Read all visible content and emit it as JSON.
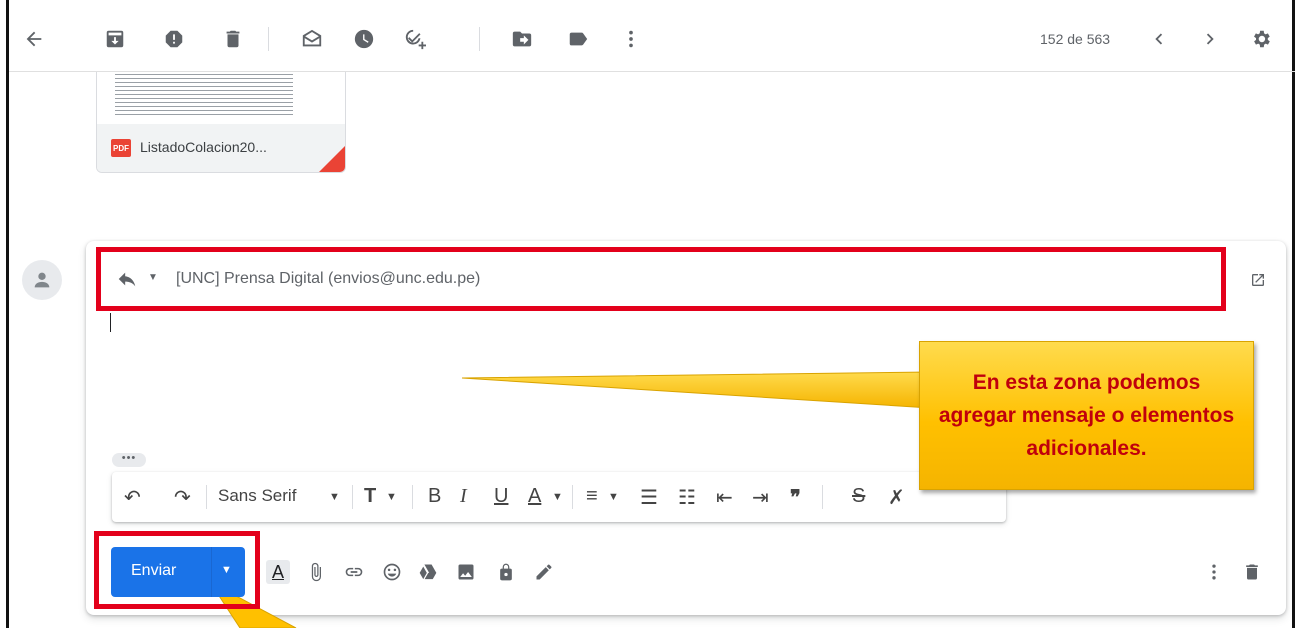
{
  "toolbar": {
    "back_icon": "arrow-left-icon",
    "icons": [
      "archive-icon",
      "report-spam-icon",
      "delete-icon",
      "mark-unread-icon",
      "snooze-icon",
      "add-task-icon",
      "move-to-icon",
      "label-icon",
      "more-vert-icon"
    ],
    "counter": "152 de 563"
  },
  "attachment": {
    "badge": "PDF",
    "name": "ListadoColacion20..."
  },
  "reply": {
    "recipient": "[UNC] Prensa Digital (envios@unc.edu.pe)"
  },
  "compose": {
    "dots": "•••",
    "format": {
      "undo": "↶",
      "redo": "↷",
      "font": "Sans Serif",
      "bold": "B",
      "italic": "I",
      "underline": "U",
      "textcolor": "A",
      "quote": "❞"
    },
    "send_label": "Enviar"
  },
  "callout": {
    "text": "En esta zona podemos agregar mensaje o elementos adicionales."
  },
  "colors": {
    "highlight_border": "#e3001b",
    "send_button": "#1a73e8",
    "callout_fill": "#ffc000",
    "callout_text": "#c0000c"
  }
}
